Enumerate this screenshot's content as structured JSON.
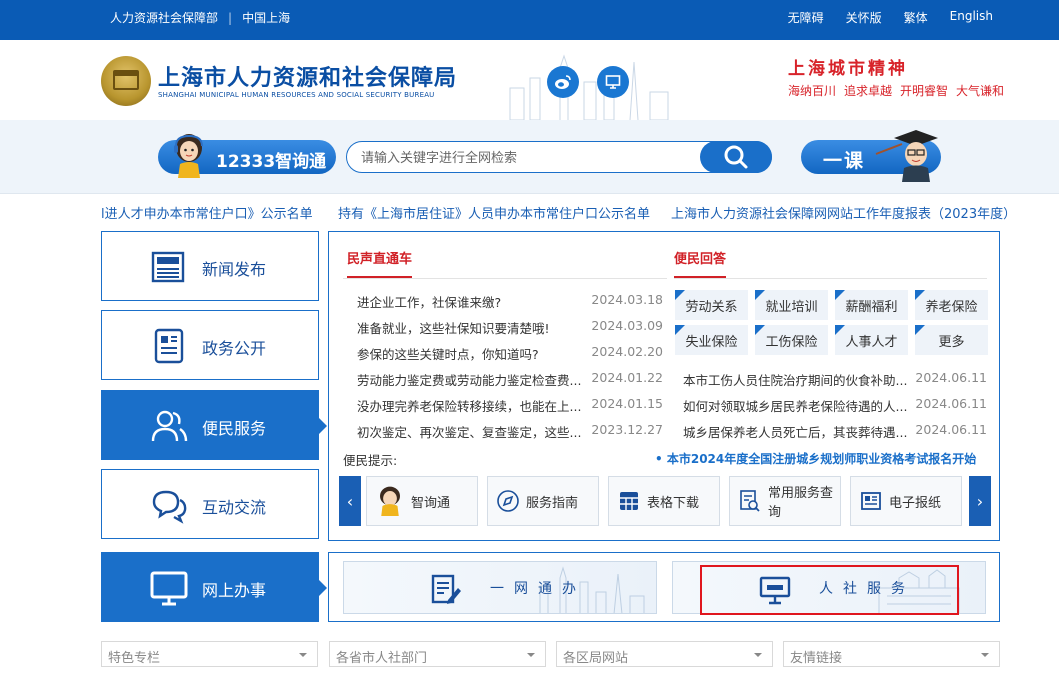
{
  "topbar": {
    "left_links": [
      "人力资源社会保障部",
      "中国上海"
    ],
    "right_links": [
      "无障碍",
      "关怀版",
      "繁体",
      "English"
    ]
  },
  "header": {
    "org_name_cn": "上海市人力资源和社会保障局",
    "org_name_en": "SHANGHAI MUNICIPAL HUMAN RESOURCES AND SOCIAL SECURITY BUREAU",
    "spirit_title": "上海城市精神",
    "spirit_values": [
      "海纳百川",
      "追求卓越",
      "开明睿智",
      "大气谦和"
    ]
  },
  "search": {
    "zxt_label": "12333智询通",
    "placeholder": "请输入关键字进行全网检索",
    "yike_label": "一课"
  },
  "notices": [
    "l进人才申办本市常住户口》公示名单",
    "持有《上海市居住证》人员申办本市常住户口公示名单",
    "上海市人力资源社会保障网网站工作年度报表（2023年度）"
  ],
  "nav": [
    {
      "label": "新闻发布",
      "icon": "newspaper-icon"
    },
    {
      "label": "政务公开",
      "icon": "document-icon"
    },
    {
      "label": "便民服务",
      "icon": "users-icon"
    },
    {
      "label": "互动交流",
      "icon": "chat-icon"
    },
    {
      "label": "网上办事",
      "icon": "monitor-icon"
    }
  ],
  "panel": {
    "news_title": "民声直通车",
    "news": [
      {
        "title": "进企业工作，社保谁来缴?",
        "date": "2024.03.18"
      },
      {
        "title": "准备就业，这些社保知识要清楚哦!",
        "date": "2024.03.09"
      },
      {
        "title": "参保的这些关键时点，你知道吗?",
        "date": "2024.02.20"
      },
      {
        "title": "劳动能力鉴定费或劳动能力鉴定检查费...",
        "date": "2024.01.22"
      },
      {
        "title": "没办理完养老保险转移接续，也能在上...",
        "date": "2024.01.15"
      },
      {
        "title": "初次鉴定、再次鉴定、复查鉴定，这些...",
        "date": "2023.12.27"
      }
    ],
    "qa_title": "便民回答",
    "tags": [
      "劳动关系",
      "就业培训",
      "薪酬福利",
      "养老保险",
      "失业保险",
      "工伤保险",
      "人事人才",
      "更多"
    ],
    "qa": [
      {
        "title": "本市工伤人员住院治疗期间的伙食补助...",
        "date": "2024.06.11"
      },
      {
        "title": "如何对领取城乡居民养老保险待遇的人...",
        "date": "2024.06.11"
      },
      {
        "title": "城乡居保养老人员死亡后，其丧葬待遇...",
        "date": "2024.06.11"
      }
    ],
    "tip_label": "便民提示:",
    "marquee": "• 本市2024年度全国注册城乡规划师职业资格考试报名开始",
    "services": [
      {
        "label": "智询通",
        "icon": "assistant-avatar-icon"
      },
      {
        "label": "服务指南",
        "icon": "compass-icon"
      },
      {
        "label": "表格下载",
        "icon": "table-icon"
      },
      {
        "label": "常用服务查询",
        "icon": "search-doc-icon"
      },
      {
        "label": "电子报纸",
        "icon": "newspaper-icon"
      }
    ],
    "prev_glyph": "‹",
    "next_glyph": "›"
  },
  "online": {
    "cards": [
      "一网通办",
      "人社服务"
    ]
  },
  "dropdowns": [
    "特色专栏",
    "各省市人社部门",
    "各区局网站",
    "友情链接"
  ],
  "colors": {
    "primary": "#1a6fc9",
    "topbar": "#0a5bb5",
    "accent_red": "#d12127"
  }
}
